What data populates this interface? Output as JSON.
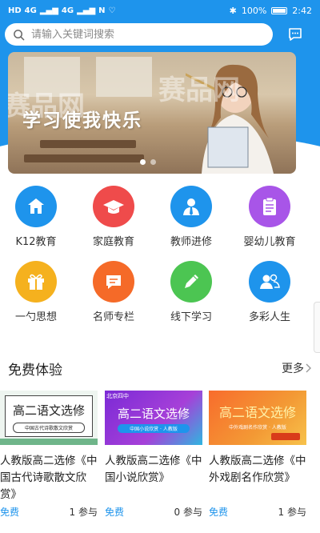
{
  "status_bar": {
    "left": [
      "HD",
      "4G",
      "4G"
    ],
    "battery": "100%",
    "time": "2:42"
  },
  "search": {
    "placeholder": "请输入关键词搜索",
    "icon": "search-icon",
    "message_icon": "message-icon"
  },
  "banner": {
    "text": "学习使我快乐",
    "watermark": "赛品网",
    "pages": 2,
    "active_page": 0
  },
  "categories": [
    {
      "label": "K12教育",
      "icon": "school-icon",
      "color": "#1e94ec"
    },
    {
      "label": "家庭教育",
      "icon": "graduation-cap-icon",
      "color": "#ef4b4b"
    },
    {
      "label": "教师进修",
      "icon": "teacher-icon",
      "color": "#1e94ec"
    },
    {
      "label": "婴幼儿教育",
      "icon": "clipboard-icon",
      "color": "#a855e8"
    },
    {
      "label": "一勺思想",
      "icon": "gift-icon",
      "color": "#f5b11e"
    },
    {
      "label": "名师专栏",
      "icon": "chat-bubble-icon",
      "color": "#f56a28"
    },
    {
      "label": "线下学习",
      "icon": "pencil-icon",
      "color": "#4cc552"
    },
    {
      "label": "多彩人生",
      "icon": "users-icon",
      "color": "#1e94ec"
    }
  ],
  "section": {
    "title": "免费体验",
    "more": "更多"
  },
  "courses": [
    {
      "thumb_title": "高二语文选修",
      "thumb_sub": "中国古代诗歌散文欣赏",
      "title": "人教版高二选修《中国古代诗歌散文欣赏》",
      "price": "免费",
      "participants": "1 参与"
    },
    {
      "thumb_title": "高二语文选修",
      "thumb_sub": "中国小说欣赏 · 人教版",
      "thumb_tag": "北京四中",
      "title": "人教版高二选修《中国小说欣赏》",
      "price": "免费",
      "participants": "0 参与"
    },
    {
      "thumb_title": "高二语文选修",
      "thumb_sub": "中外戏剧名作欣赏 · 人教版",
      "title": "人教版高二选修《中外戏剧名作欣赏》",
      "price": "免费",
      "participants": "1 参与"
    }
  ]
}
